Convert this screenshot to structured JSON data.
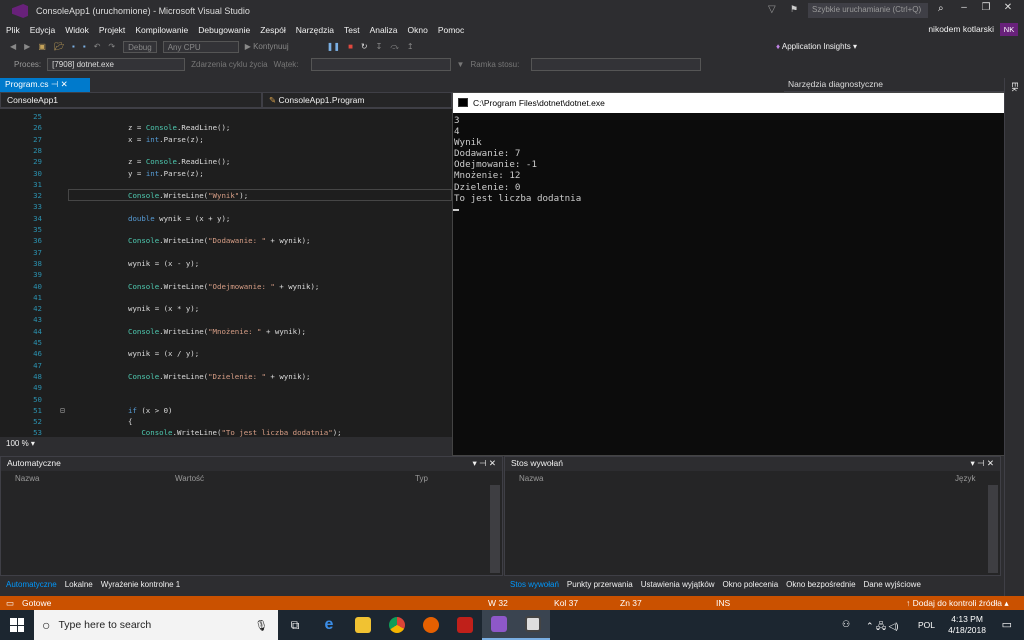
{
  "title_bar": {
    "title": "ConsoleApp1 (uruchomione) - Microsoft Visual Studio",
    "quick_launch": "Szybkie uruchamianie (Ctrl+Q)"
  },
  "menu": {
    "items": [
      "Plik",
      "Edycja",
      "Widok",
      "Projekt",
      "Kompilowanie",
      "Debugowanie",
      "Zespół",
      "Narzędzia",
      "Test",
      "Analiza",
      "Okno",
      "Pomoc"
    ],
    "user": "nikodem kotlarski",
    "avatar": "NK"
  },
  "toolbar": {
    "config": "Debug",
    "platform": "Any CPU",
    "continue": "Kontynuuj",
    "app_insights": "Application Insights"
  },
  "process_bar": {
    "label": "Proces:",
    "value": "[7908] dotnet.exe",
    "lifecycle": "Zdarzenia cyklu życia",
    "thread": "Wątek:",
    "stack_frame": "Ramka stosu:"
  },
  "tabs": {
    "file": "Program.cs",
    "diagnostics": "Narzędzia diagnostyczne"
  },
  "editor": {
    "project": "ConsoleApp1",
    "class": "ConsoleApp1.Program",
    "zoom": "100 %",
    "lines": [
      {
        "n": "25",
        "code": ""
      },
      {
        "n": "26",
        "code": "z = Console.ReadLine();"
      },
      {
        "n": "27",
        "code": "x = int.Parse(z);"
      },
      {
        "n": "28",
        "code": ""
      },
      {
        "n": "29",
        "code": "z = Console.ReadLine();"
      },
      {
        "n": "30",
        "code": "y = int.Parse(z);"
      },
      {
        "n": "31",
        "code": ""
      },
      {
        "n": "32",
        "code": "Console.WriteLine(\"Wynik\");"
      },
      {
        "n": "33",
        "code": ""
      },
      {
        "n": "34",
        "code": "double wynik = (x + y);"
      },
      {
        "n": "35",
        "code": ""
      },
      {
        "n": "36",
        "code": "Console.WriteLine(\"Dodawanie: \" + wynik);"
      },
      {
        "n": "37",
        "code": ""
      },
      {
        "n": "38",
        "code": "wynik = (x - y);"
      },
      {
        "n": "39",
        "code": ""
      },
      {
        "n": "40",
        "code": "Console.WriteLine(\"Odejmowanie: \" + wynik);"
      },
      {
        "n": "41",
        "code": ""
      },
      {
        "n": "42",
        "code": "wynik = (x * y);"
      },
      {
        "n": "43",
        "code": ""
      },
      {
        "n": "44",
        "code": "Console.WriteLine(\"Mnożenie: \" + wynik);"
      },
      {
        "n": "45",
        "code": ""
      },
      {
        "n": "46",
        "code": "wynik = (x / y);"
      },
      {
        "n": "47",
        "code": ""
      },
      {
        "n": "48",
        "code": "Console.WriteLine(\"Dzielenie: \" + wynik);"
      },
      {
        "n": "49",
        "code": ""
      },
      {
        "n": "50",
        "code": ""
      },
      {
        "n": "51",
        "code": "if (x > 0)"
      },
      {
        "n": "52",
        "code": "{"
      },
      {
        "n": "53",
        "code": "   Console.WriteLine(\"To jest liczba dodatnia\");"
      }
    ]
  },
  "console": {
    "title": "C:\\Program Files\\dotnet\\dotnet.exe",
    "output": "3\n4\nWynik\nDodawanie: 7\nOdejmowanie: -1\nMnożenie: 12\nDzielenie: 0\nTo jest liczba dodatnia"
  },
  "autos_panel": {
    "title": "Automatyczne",
    "columns": [
      "Nazwa",
      "Wartość",
      "Typ"
    ],
    "tabs": [
      "Automatyczne",
      "Lokalne",
      "Wyrażenie kontrolne 1"
    ]
  },
  "callstack_panel": {
    "title": "Stos wywołań",
    "columns": [
      "Nazwa",
      "Język"
    ],
    "tabs": [
      "Stos wywołań",
      "Punkty przerwania",
      "Ustawienia wyjątków",
      "Okno polecenia",
      "Okno bezpośrednie",
      "Dane wyjściowe"
    ]
  },
  "status_bar": {
    "ready": "Gotowe",
    "line": "W 32",
    "col": "Kol 37",
    "char": "Zn 37",
    "mode": "INS",
    "source_control": "Dodaj do kontroli źródła"
  },
  "taskbar": {
    "search": "Type here to search",
    "lang": "POL",
    "time": "4:13 PM",
    "date": "4/18/2018"
  },
  "colors": {
    "accent": "#007acc",
    "status": "#ca5100",
    "vs_purple": "#68217a"
  }
}
